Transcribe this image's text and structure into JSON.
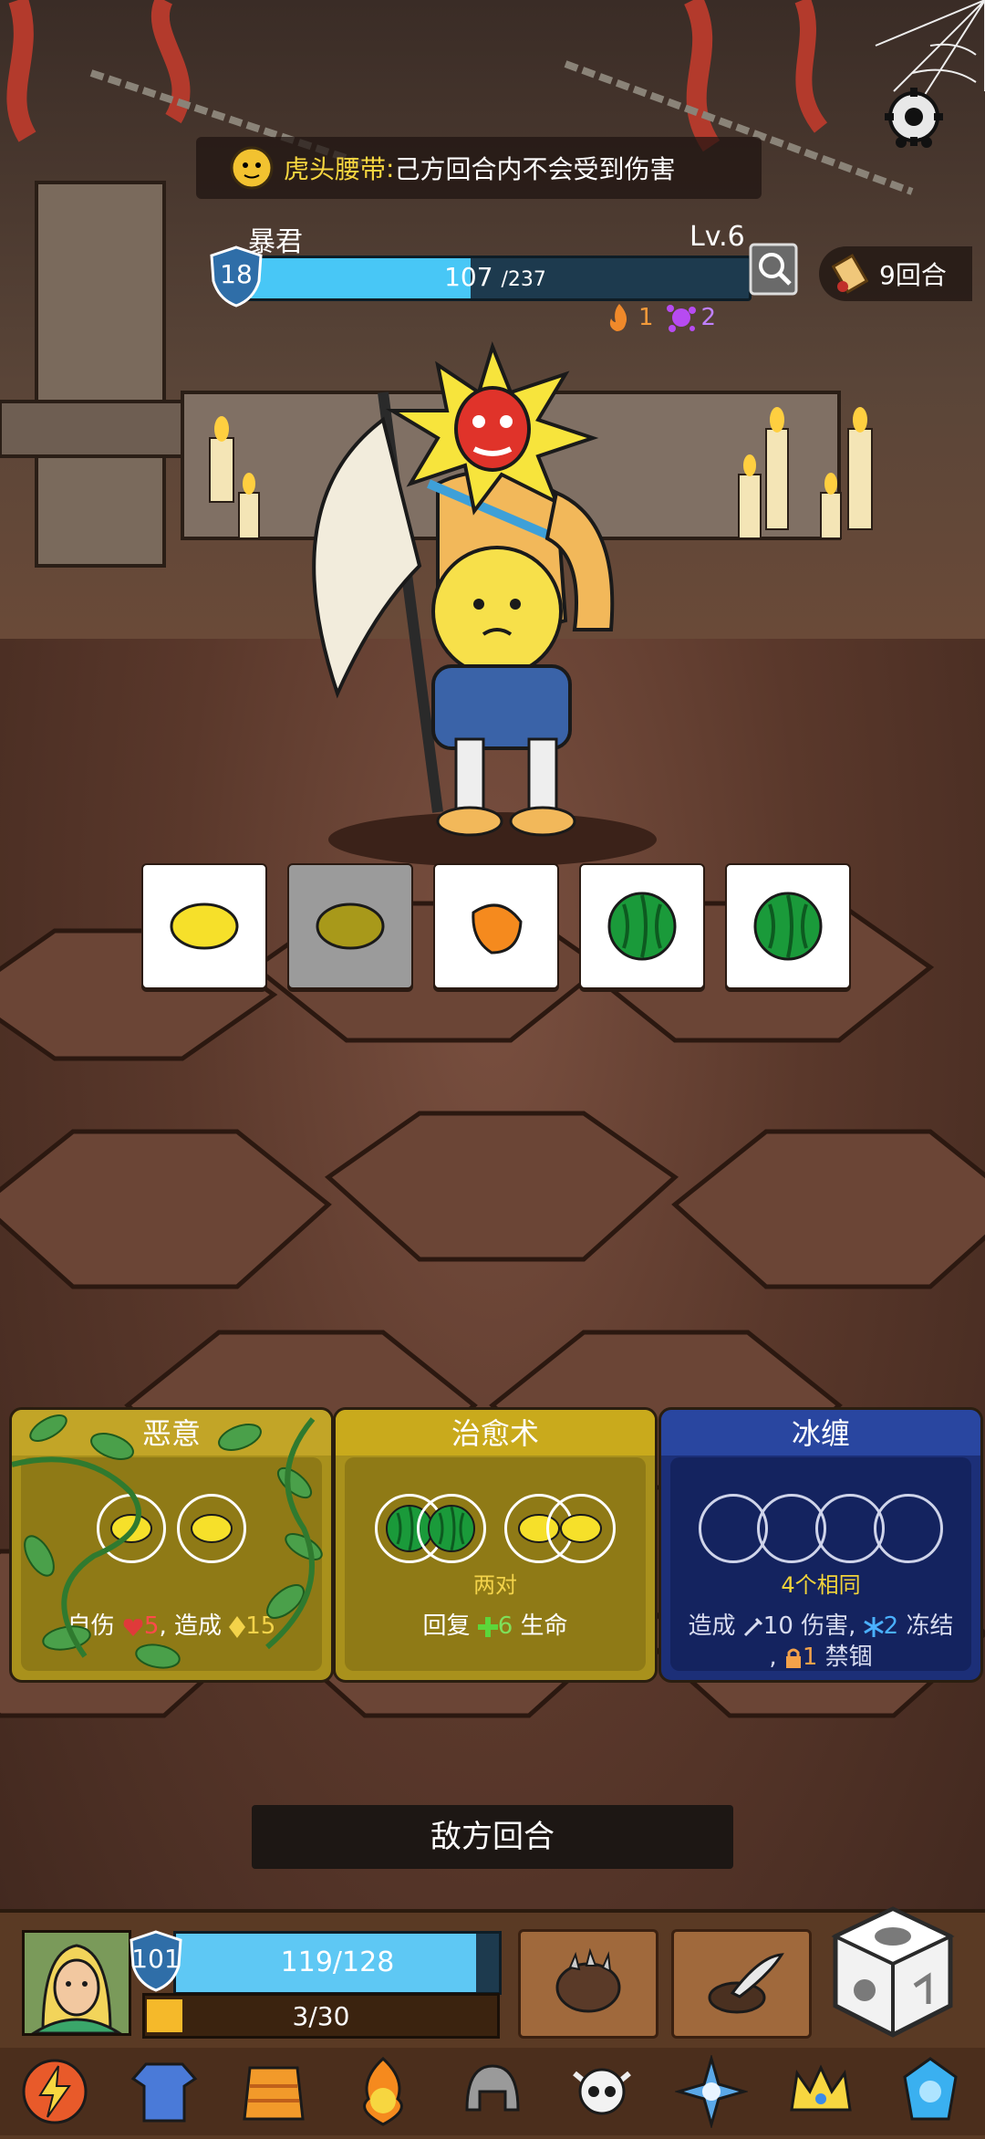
{
  "buff": {
    "name": "虎头腰带",
    "separator": ":",
    "desc": "己方回合内不会受到伤害"
  },
  "enemy": {
    "name": "暴君",
    "level": "Lv.6",
    "shield": "18",
    "hp": "107",
    "hp_max": "/237",
    "hp_fraction": 0.4515
  },
  "rounds": "9回合",
  "status": {
    "fire": "1",
    "poison": "2"
  },
  "dice": [
    {
      "face": "lemon-icon",
      "used": false
    },
    {
      "face": "lemon-icon",
      "used": true
    },
    {
      "face": "orange-icon",
      "used": false
    },
    {
      "face": "watermelon-icon",
      "used": false
    },
    {
      "face": "watermelon-icon",
      "used": false
    }
  ],
  "cards": {
    "card1": {
      "title": "恶意",
      "effect_prefix": "自伤",
      "self_damage": "5",
      "effect_mid": ", 造成",
      "gold": "15"
    },
    "card2": {
      "title": "治愈术",
      "requirement": "两对",
      "effect_prefix": "回复",
      "heal": "6",
      "effect_suffix": "生命"
    },
    "card3": {
      "title": "冰缠",
      "requirement": "4个相同",
      "line1_prefix": "造成",
      "damage": "10",
      "line1_mid": "伤害,",
      "freeze": "2",
      "line1_suffix": "冻结",
      "line2_prefix": ",",
      "bind": "1",
      "line2_suffix": "禁锢"
    }
  },
  "turn_label": "敌方回合",
  "player": {
    "shield": "101",
    "hp": "119/128",
    "hp_fraction": 0.9297,
    "exp": "3/30",
    "exp_fraction": 0.1
  },
  "colors": {
    "hp_blue": "#48c7f6",
    "gold": "#f3d34a",
    "heart_red": "#ff4a4a",
    "heal_green": "#7fe05a",
    "freeze_blue": "#4ab0ff"
  },
  "bottom_icons": [
    "lightning-icon",
    "tunic-icon",
    "fur-armor-icon",
    "flame-gauntlet-icon",
    "helmet-icon",
    "skull-icon",
    "compass-star-icon",
    "crown-icon",
    "blue-crystal-icon"
  ]
}
